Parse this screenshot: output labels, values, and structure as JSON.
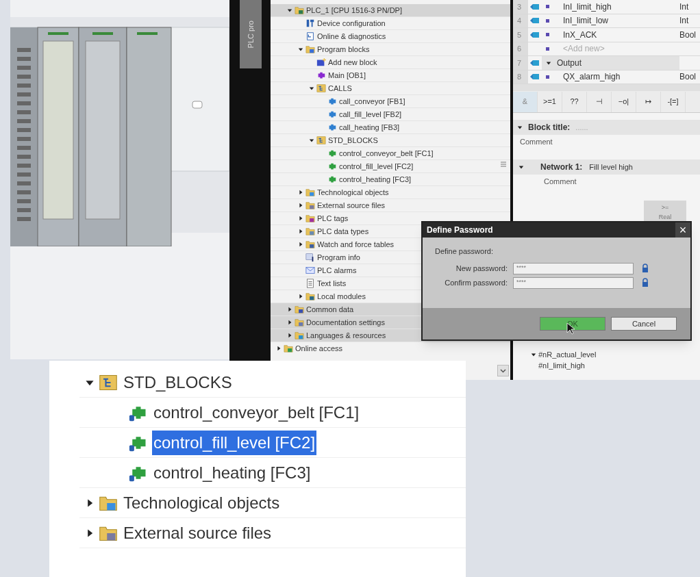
{
  "side_tab": {
    "label": "PLC pro"
  },
  "project_tree": {
    "items": [
      {
        "label": "PLC_1 [CPU 1516-3 PN/DP]",
        "kind": "cpu",
        "expanded": true,
        "children": [
          {
            "label": "Device configuration",
            "kind": "device"
          },
          {
            "label": "Online & diagnostics",
            "kind": "diag"
          },
          {
            "label": "Program blocks",
            "kind": "blocks_folder",
            "expanded": true,
            "children": [
              {
                "label": "Add new block",
                "kind": "add"
              },
              {
                "label": "Main [OB1]",
                "kind": "ob"
              },
              {
                "label": "CALLS",
                "kind": "group",
                "expanded": true,
                "children": [
                  {
                    "label": "call_conveyor [FB1]",
                    "kind": "fb"
                  },
                  {
                    "label": "call_fill_level [FB2]",
                    "kind": "fb"
                  },
                  {
                    "label": "call_heating [FB3]",
                    "kind": "fb"
                  }
                ]
              },
              {
                "label": "STD_BLOCKS",
                "kind": "group",
                "expanded": true,
                "children": [
                  {
                    "label": "control_conveyor_belt [FC1]",
                    "kind": "fc"
                  },
                  {
                    "label": "control_fill_level [FC2]",
                    "kind": "fc"
                  },
                  {
                    "label": "control_heating [FC3]",
                    "kind": "fc"
                  }
                ]
              }
            ]
          },
          {
            "label": "Technological objects",
            "kind": "tech",
            "expanded": false
          },
          {
            "label": "External source files",
            "kind": "ext",
            "expanded": false
          },
          {
            "label": "PLC tags",
            "kind": "tags",
            "expanded": false
          },
          {
            "label": "PLC data types",
            "kind": "types",
            "expanded": false
          },
          {
            "label": "Watch and force tables",
            "kind": "watch",
            "expanded": false
          },
          {
            "label": "Program info",
            "kind": "info"
          },
          {
            "label": "PLC alarms",
            "kind": "alarms"
          },
          {
            "label": "Text lists",
            "kind": "textlist"
          },
          {
            "label": "Local modules",
            "kind": "modules",
            "expanded": false
          }
        ]
      },
      {
        "label": "Common data",
        "kind": "common",
        "expanded": false
      },
      {
        "label": "Documentation settings",
        "kind": "docs",
        "expanded": false
      },
      {
        "label": "Languages & resources",
        "kind": "lang",
        "expanded": false
      }
    ],
    "online_access": {
      "label": "Online access",
      "kind": "online",
      "expanded": false
    }
  },
  "interface_table": {
    "rows": [
      {
        "number": "3",
        "kind": "var",
        "name": "InI_limit_high",
        "data_type": "Int"
      },
      {
        "number": "4",
        "kind": "var",
        "name": "InI_limit_low",
        "data_type": "Int"
      },
      {
        "number": "5",
        "kind": "var",
        "name": "InX_ACK",
        "data_type": "Bool"
      },
      {
        "number": "6",
        "kind": "add",
        "name": "<Add new>"
      },
      {
        "number": "7",
        "kind": "section",
        "name": "Output",
        "expanded": true
      },
      {
        "number": "8",
        "kind": "var",
        "name": "QX_alarm_high",
        "data_type": "Bool"
      }
    ]
  },
  "ladder_toolbar": [
    "&",
    ">=1",
    "??",
    "⊣",
    "−o|",
    "↦",
    "-[=]"
  ],
  "block_title": {
    "label": "Block title:",
    "placeholder": "......",
    "comment": "Comment",
    "expanded": true
  },
  "network": {
    "label": "Network 1:",
    "title": "Fill level high",
    "comment": "Comment",
    "expanded": true
  },
  "compare_box": {
    "operator": ">=",
    "type": "Real"
  },
  "variables": [
    {
      "name": "#nR_actual_level",
      "expanded": true
    },
    {
      "name": "#nI_limit_high"
    }
  ],
  "dialog": {
    "title": "Define Password",
    "close": "×",
    "prompt": "Define password:",
    "fields": [
      {
        "label": "New password:",
        "value": "****"
      },
      {
        "label": "Confirm password:",
        "value": "****"
      }
    ],
    "buttons": [
      {
        "label": "OK",
        "primary": true
      },
      {
        "label": "Cancel",
        "primary": false
      }
    ]
  },
  "inset": {
    "items": [
      {
        "label": "STD_BLOCKS",
        "kind": "group",
        "expanded": true,
        "children": [
          {
            "label": "control_conveyor_belt [FC1]",
            "kind": "fc",
            "selected": false
          },
          {
            "label": "control_fill_level [FC2]",
            "kind": "fc",
            "selected": true
          },
          {
            "label": "control_heating [FC3]",
            "kind": "fc",
            "selected": false
          }
        ]
      },
      {
        "label": "Technological objects",
        "kind": "tech",
        "expanded": false
      },
      {
        "label": "External source files",
        "kind": "ext",
        "expanded": false
      }
    ]
  }
}
